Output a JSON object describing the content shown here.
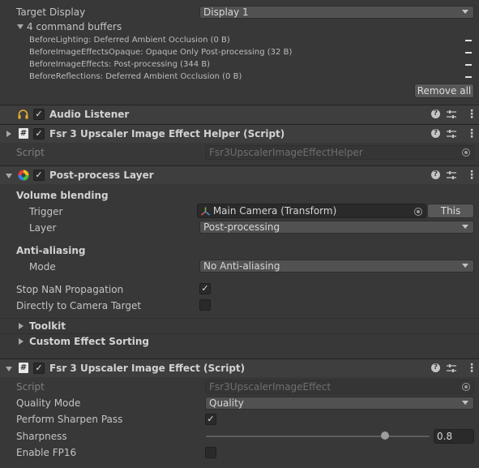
{
  "camera": {
    "target_display_label": "Target Display",
    "target_display_value": "Display 1",
    "command_buffers_label": "4 command buffers",
    "command_buffers": [
      "BeforeLighting: Deferred Ambient Occlusion (0 B)",
      "BeforeImageEffectsOpaque: Opaque Only Post-processing (32 B)",
      "BeforeImageEffects: Post-processing (344 B)",
      "BeforeReflections: Deferred Ambient Occlusion (0 B)"
    ],
    "remove_all_label": "Remove all"
  },
  "audio_listener": {
    "title": "Audio Listener"
  },
  "fsr_helper": {
    "title": "Fsr 3 Upscaler Image Effect Helper (Script)",
    "script_label": "Script",
    "script_value": "Fsr3UpscalerImageEffectHelper"
  },
  "post_process_layer": {
    "title": "Post-process Layer",
    "volume_blending_label": "Volume blending",
    "trigger_label": "Trigger",
    "trigger_value": "Main Camera (Transform)",
    "this_button_label": "This",
    "layer_label": "Layer",
    "layer_value": "Post-processing",
    "anti_aliasing_label": "Anti-aliasing",
    "mode_label": "Mode",
    "mode_value": "No Anti-aliasing",
    "stop_nan_label": "Stop NaN Propagation",
    "stop_nan_checked": true,
    "direct_target_label": "Directly to Camera Target",
    "direct_target_checked": false,
    "toolkit_label": "Toolkit",
    "custom_sorting_label": "Custom Effect Sorting"
  },
  "fsr_effect": {
    "title": "Fsr 3 Upscaler Image Effect (Script)",
    "script_label": "Script",
    "script_value": "Fsr3UpscalerImageEffect",
    "quality_mode_label": "Quality Mode",
    "quality_mode_value": "Quality",
    "sharpen_pass_label": "Perform Sharpen Pass",
    "sharpen_pass_checked": true,
    "sharpness_label": "Sharpness",
    "sharpness_value": "0.8",
    "sharpness_fraction": 0.8,
    "fp16_label": "Enable FP16",
    "fp16_checked": false
  },
  "icons": {
    "checkmark": "✓",
    "help": "?",
    "more": "⋮"
  }
}
